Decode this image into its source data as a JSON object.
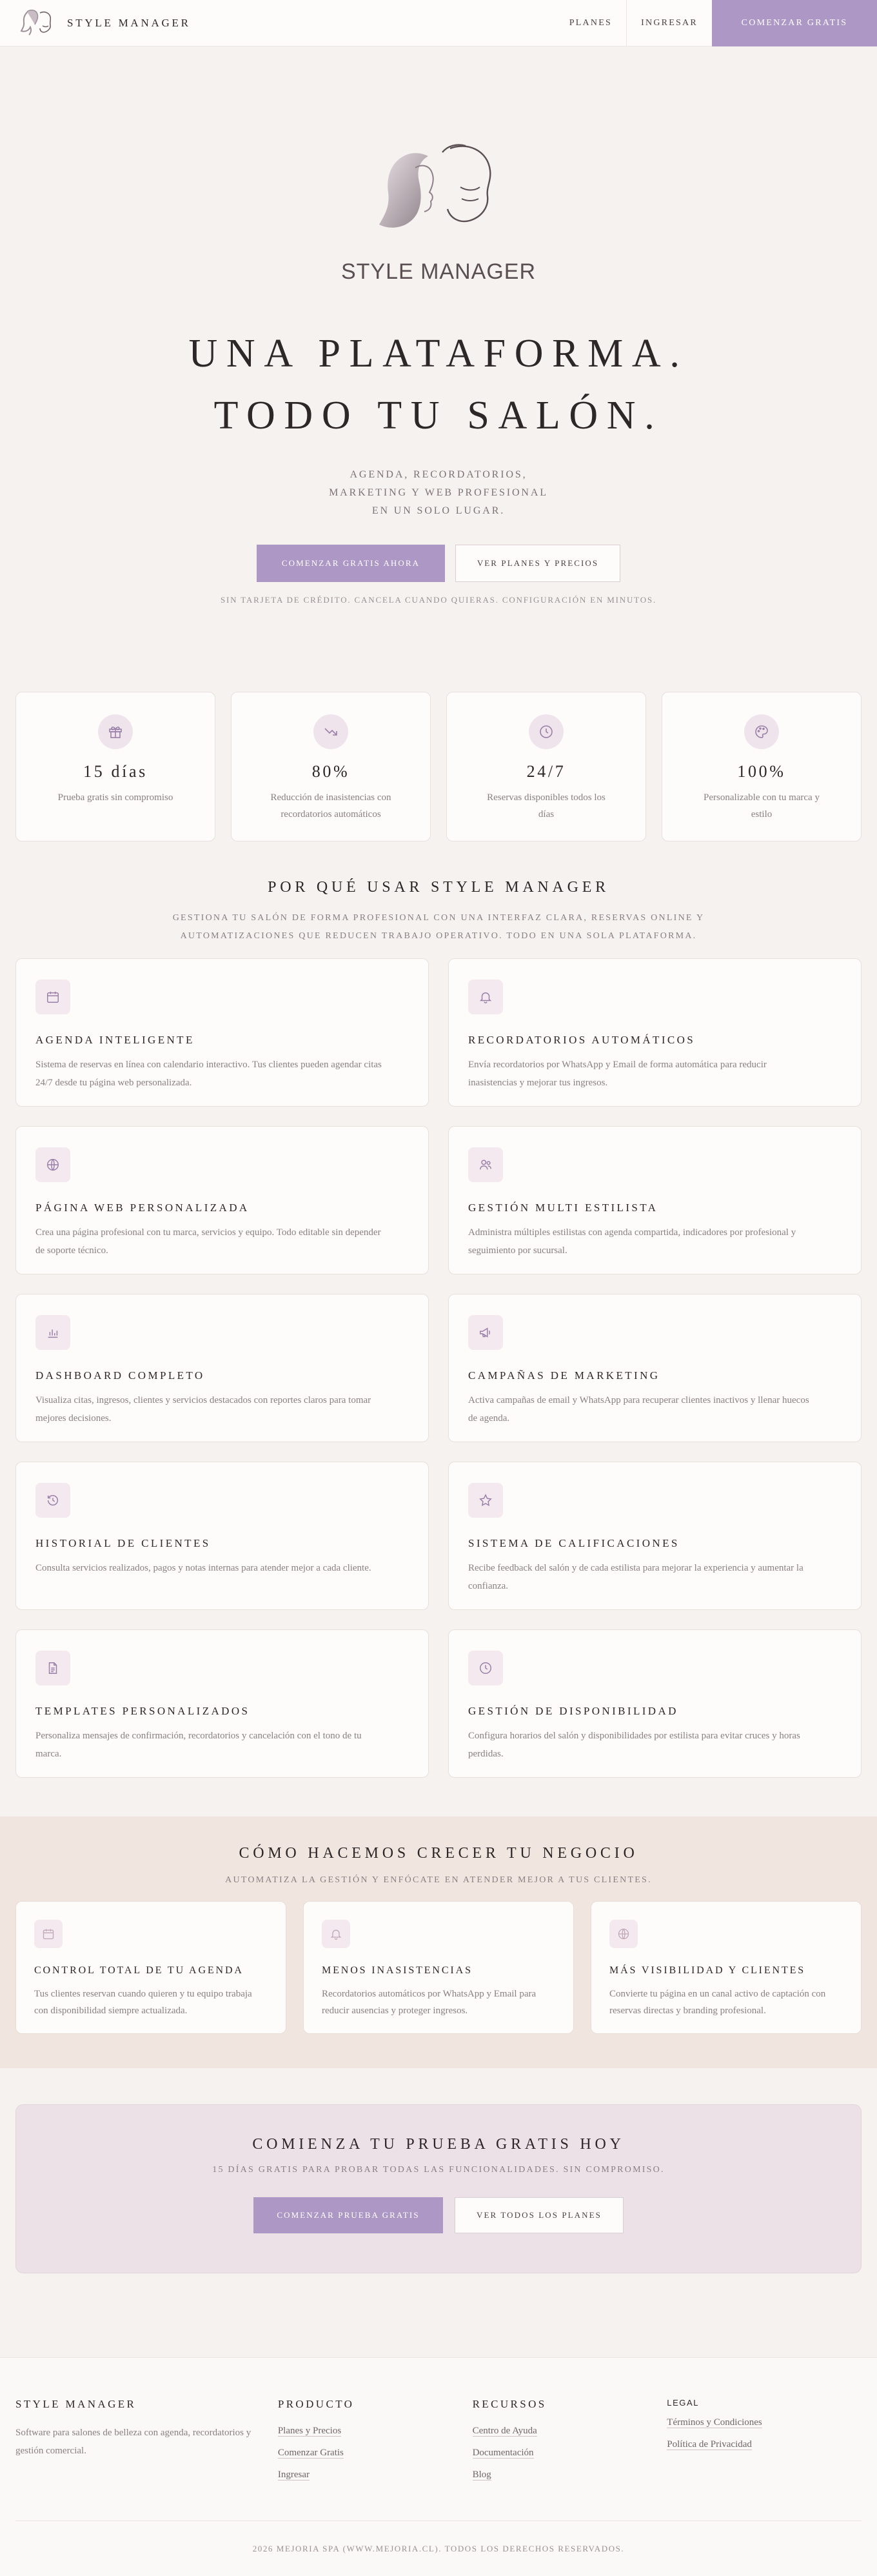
{
  "nav": {
    "brand": "STYLE MANAGER",
    "links": [
      "PLANES",
      "INGRESAR"
    ],
    "cta": "COMENZAR GRATIS"
  },
  "hero": {
    "logo_text": "STYLE MANAGER",
    "title_line1": "UNA PLATAFORMA.",
    "title_line2": "TODO TU SALÓN.",
    "sub_line1": "AGENDA, RECORDATORIOS,",
    "sub_line2": "MARKETING Y WEB PROFESIONAL",
    "sub_line3": "EN UN SOLO LUGAR.",
    "primary_button": "COMENZAR GRATIS AHORA",
    "secondary_button": "VER PLANES Y PRECIOS",
    "note": "SIN TARJETA DE CRÉDITO. CANCELA CUANDO QUIERAS. CONFIGURACIÓN EN MINUTOS."
  },
  "stats": [
    {
      "icon": "gift-icon",
      "value": "15 días",
      "label": "Prueba gratis sin compromiso"
    },
    {
      "icon": "trending-down-icon",
      "value": "80%",
      "label": "Reducción de inasistencias con recordatorios automáticos"
    },
    {
      "icon": "clock-icon",
      "value": "24/7",
      "label": "Reservas disponibles todos los días"
    },
    {
      "icon": "palette-icon",
      "value": "100%",
      "label": "Personalizable con tu marca y estilo"
    }
  ],
  "why": {
    "title": "POR QUÉ USAR STYLE MANAGER",
    "desc_line1": "GESTIONA TU SALÓN DE FORMA PROFESIONAL CON UNA INTERFAZ CLARA, RESERVAS ONLINE Y",
    "desc_line2": "AUTOMATIZACIONES QUE REDUCEN TRABAJO OPERATIVO. TODO EN UNA SOLA PLATAFORMA.",
    "features": [
      {
        "icon": "calendar-icon",
        "title": "AGENDA INTELIGENTE",
        "desc": "Sistema de reservas en línea con calendario interactivo. Tus clientes pueden agendar citas 24/7 desde tu página web personalizada."
      },
      {
        "icon": "bell-icon",
        "title": "RECORDATORIOS AUTOMÁTICOS",
        "desc": "Envía recordatorios por WhatsApp y Email de forma automática para reducir inasistencias y mejorar tus ingresos."
      },
      {
        "icon": "globe-icon",
        "title": "PÁGINA WEB PERSONALIZADA",
        "desc": "Crea una página profesional con tu marca, servicios y equipo. Todo editable sin depender de soporte técnico."
      },
      {
        "icon": "users-icon",
        "title": "GESTIÓN MULTI ESTILISTA",
        "desc": "Administra múltiples estilistas con agenda compartida, indicadores por profesional y seguimiento por sucursal."
      },
      {
        "icon": "bar-chart-icon",
        "title": "DASHBOARD COMPLETO",
        "desc": "Visualiza citas, ingresos, clientes y servicios destacados con reportes claros para tomar mejores decisiones."
      },
      {
        "icon": "megaphone-icon",
        "title": "CAMPAÑAS DE MARKETING",
        "desc": "Activa campañas de email y WhatsApp para recuperar clientes inactivos y llenar huecos de agenda."
      },
      {
        "icon": "history-icon",
        "title": "HISTORIAL DE CLIENTES",
        "desc": "Consulta servicios realizados, pagos y notas internas para atender mejor a cada cliente."
      },
      {
        "icon": "star-icon",
        "title": "SISTEMA DE CALIFICACIONES",
        "desc": "Recibe feedback del salón y de cada estilista para mejorar la experiencia y aumentar la confianza."
      },
      {
        "icon": "document-icon",
        "title": "TEMPLATES PERSONALIZADOS",
        "desc": "Personaliza mensajes de confirmación, recordatorios y cancelación con el tono de tu marca."
      },
      {
        "icon": "clock-icon",
        "title": "GESTIÓN DE DISPONIBILIDAD",
        "desc": "Configura horarios del salón y disponibilidades por estilista para evitar cruces y horas perdidas."
      }
    ]
  },
  "grow": {
    "title": "CÓMO HACEMOS CRECER TU NEGOCIO",
    "desc": "AUTOMATIZA LA GESTIÓN Y ENFÓCATE EN ATENDER MEJOR A TUS CLIENTES.",
    "cards": [
      {
        "icon": "calendar-icon",
        "title": "CONTROL TOTAL DE TU AGENDA",
        "desc": "Tus clientes reservan cuando quieren y tu equipo trabaja con disponibilidad siempre actualizada."
      },
      {
        "icon": "bell-icon",
        "title": "MENOS INASISTENCIAS",
        "desc": "Recordatorios automáticos por WhatsApp y Email para reducir ausencias y proteger ingresos."
      },
      {
        "icon": "globe-icon",
        "title": "MÁS VISIBILIDAD Y CLIENTES",
        "desc": "Convierte tu página en un canal activo de captación con reservas directas y branding profesional."
      }
    ]
  },
  "trial": {
    "title": "COMIENZA TU PRUEBA GRATIS HOY",
    "desc": "15 DÍAS GRATIS PARA PROBAR TODAS LAS FUNCIONALIDADES. SIN COMPROMISO.",
    "primary_button": "COMENZAR PRUEBA GRATIS",
    "secondary_button": "VER TODOS LOS PLANES"
  },
  "footer": {
    "brand": "STYLE MANAGER",
    "brand_desc": "Software para salones de belleza con agenda, recordatorios y gestión comercial.",
    "producto_title": "PRODUCTO",
    "producto_links": [
      "Planes y Precios",
      "Comenzar Gratis",
      "Ingresar"
    ],
    "recursos_title": "RECURSOS",
    "recursos_links": [
      "Centro de Ayuda",
      "Documentación",
      "Blog"
    ],
    "legal_title": "LEGAL",
    "legal_links": [
      "Términos y Condiciones",
      "Política de Privacidad"
    ],
    "copyright": "2026 MEJORIA SPA (WWW.MEJORIA.CL). TODOS LOS DERECHOS RESERVADOS."
  },
  "colors": {
    "accent": "#ad97c4",
    "background": "#f6f2ef",
    "grow_band": "#f1e6df",
    "trial_band": "#ece1e6"
  }
}
